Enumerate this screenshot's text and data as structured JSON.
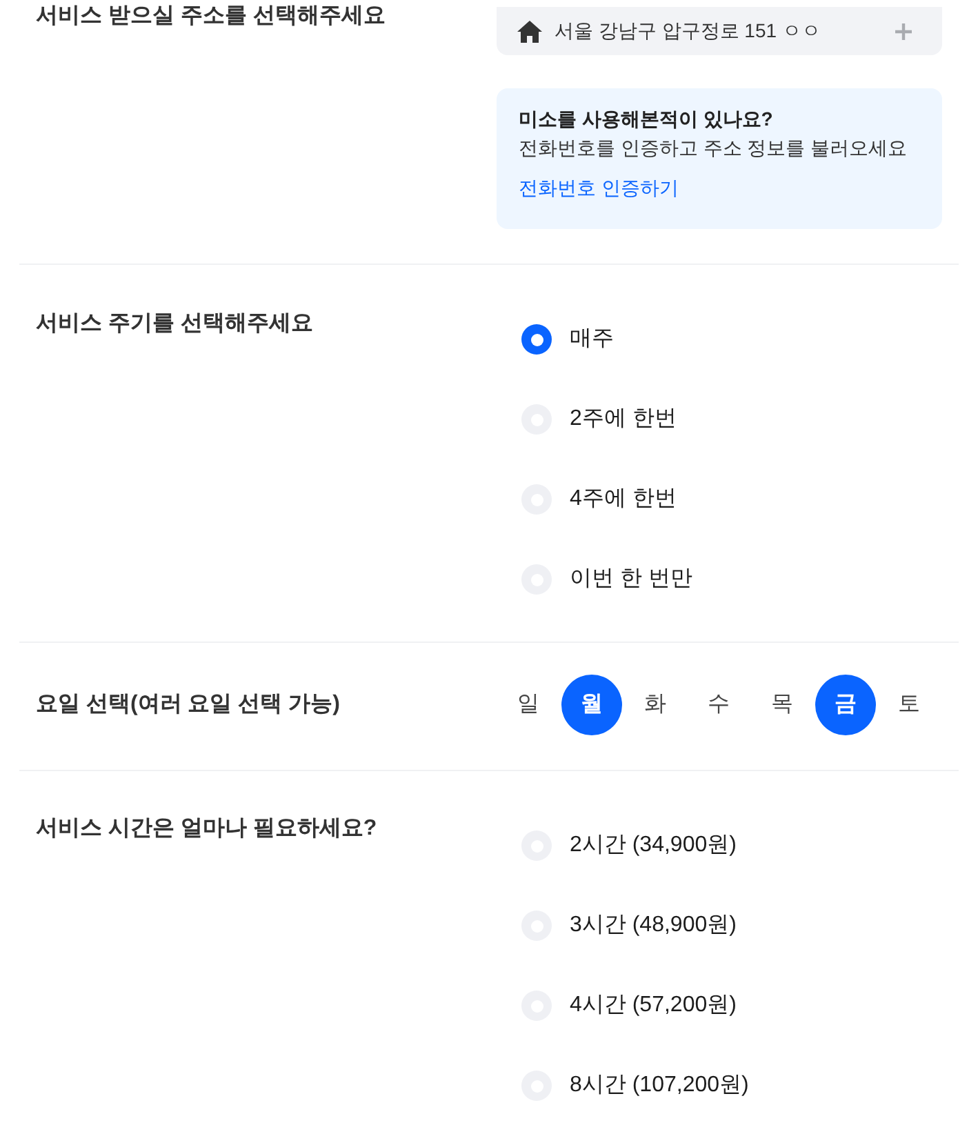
{
  "address_section": {
    "heading": "서비스 받으실 주소를 선택해주세요",
    "address": {
      "text": "서울 강남구 압구정로 151 ㅇㅇ"
    },
    "info": {
      "title": "미소를 사용해본적이 있나요?",
      "text": "전화번호를 인증하고 주소 정보를 불러오세요",
      "link": "전화번호 인증하기"
    }
  },
  "frequency_section": {
    "heading": "서비스 주기를 선택해주세요",
    "options": [
      {
        "label": "매주",
        "selected": true
      },
      {
        "label": "2주에 한번",
        "selected": false
      },
      {
        "label": "4주에 한번",
        "selected": false
      },
      {
        "label": "이번 한 번만",
        "selected": false
      }
    ]
  },
  "days_section": {
    "heading": "요일 선택(여러 요일 선택 가능)",
    "days": [
      {
        "label": "일",
        "selected": false
      },
      {
        "label": "월",
        "selected": true
      },
      {
        "label": "화",
        "selected": false
      },
      {
        "label": "수",
        "selected": false
      },
      {
        "label": "목",
        "selected": false
      },
      {
        "label": "금",
        "selected": true
      },
      {
        "label": "토",
        "selected": false
      }
    ]
  },
  "duration_section": {
    "heading": "서비스 시간은 얼마나 필요하세요?",
    "options": [
      {
        "label": "2시간 (34,900원)",
        "selected": false
      },
      {
        "label": "3시간 (48,900원)",
        "selected": false
      },
      {
        "label": "4시간 (57,200원)",
        "selected": false
      },
      {
        "label": "8시간 (107,200원)",
        "selected": false
      }
    ]
  }
}
